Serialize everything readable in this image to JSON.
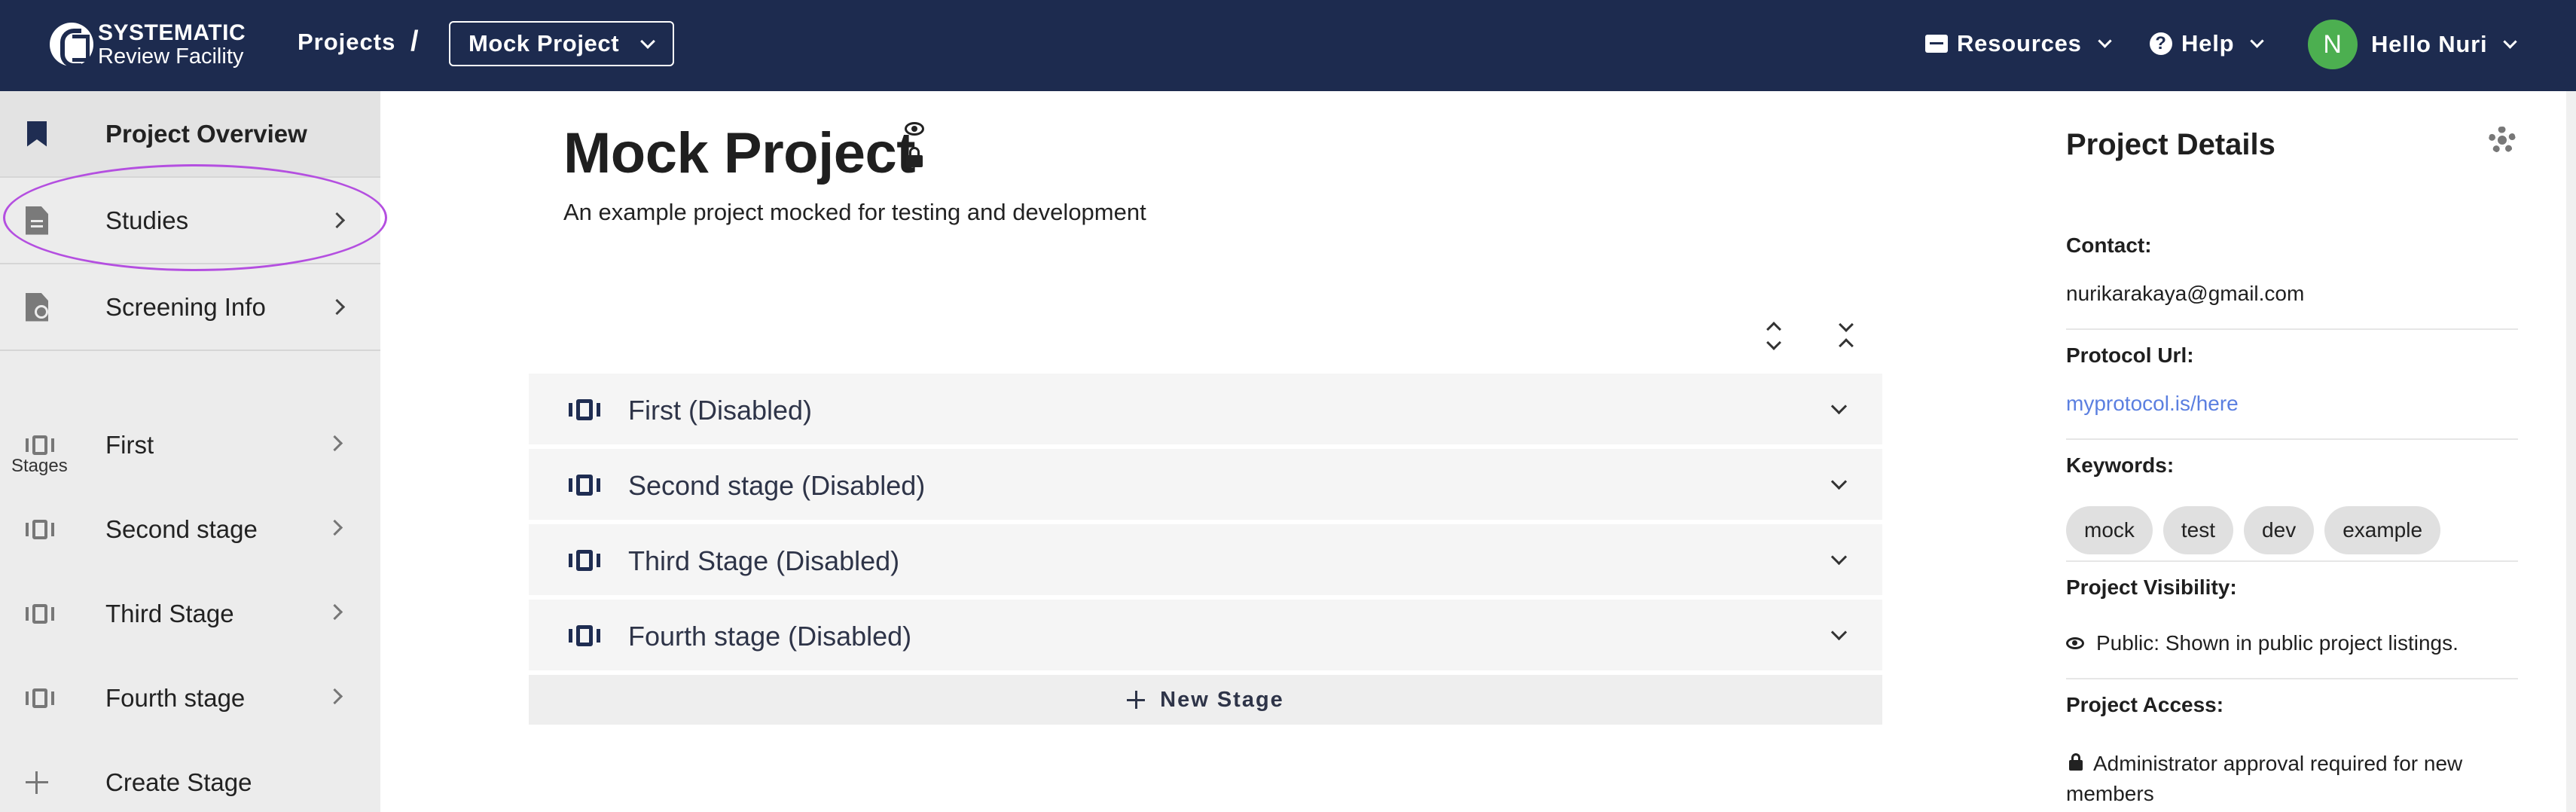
{
  "header": {
    "logo_line1": "SYSTEMATIC",
    "logo_line2": "Review Facility",
    "breadcrumb_projects": "Projects",
    "breadcrumb_sep": "/",
    "project_select": "Mock Project",
    "resources": "Resources",
    "help": "Help",
    "avatar_initial": "N",
    "user_greeting": "Hello Nuri"
  },
  "sidebar": {
    "items": [
      {
        "label": "Project Overview",
        "icon": "bookmark-icon"
      },
      {
        "label": "Studies",
        "icon": "document-icon"
      },
      {
        "label": "Screening Info",
        "icon": "screening-icon"
      }
    ],
    "stages_heading": "Stages",
    "stages": [
      {
        "label": "First"
      },
      {
        "label": "Second stage"
      },
      {
        "label": "Third Stage"
      },
      {
        "label": "Fourth stage"
      }
    ],
    "create_stage": "Create Stage"
  },
  "main": {
    "title": "Mock Project",
    "subtitle": "An example project mocked for testing and development",
    "stage_panels": [
      {
        "label": "First (Disabled)"
      },
      {
        "label": "Second stage (Disabled)"
      },
      {
        "label": "Third Stage (Disabled)"
      },
      {
        "label": "Fourth stage (Disabled)"
      }
    ],
    "new_stage": "New Stage"
  },
  "details": {
    "title": "Project Details",
    "contact_label": "Contact:",
    "contact_value": "nurikarakaya@gmail.com",
    "protocol_label": "Protocol Url:",
    "protocol_value": "myprotocol.is/here",
    "keywords_label": "Keywords:",
    "keywords": [
      "mock",
      "test",
      "dev",
      "example"
    ],
    "visibility_label": "Project Visibility:",
    "visibility_value": "Public: Shown in public project listings.",
    "access_label": "Project Access:",
    "access_value": "Administrator approval required for new members"
  },
  "colors": {
    "header_bg": "#1d2b4f",
    "sidebar_bg": "#ececec",
    "highlight_circle": "#b44fe0",
    "link": "#5b7fe0",
    "avatar": "#4caf50"
  }
}
